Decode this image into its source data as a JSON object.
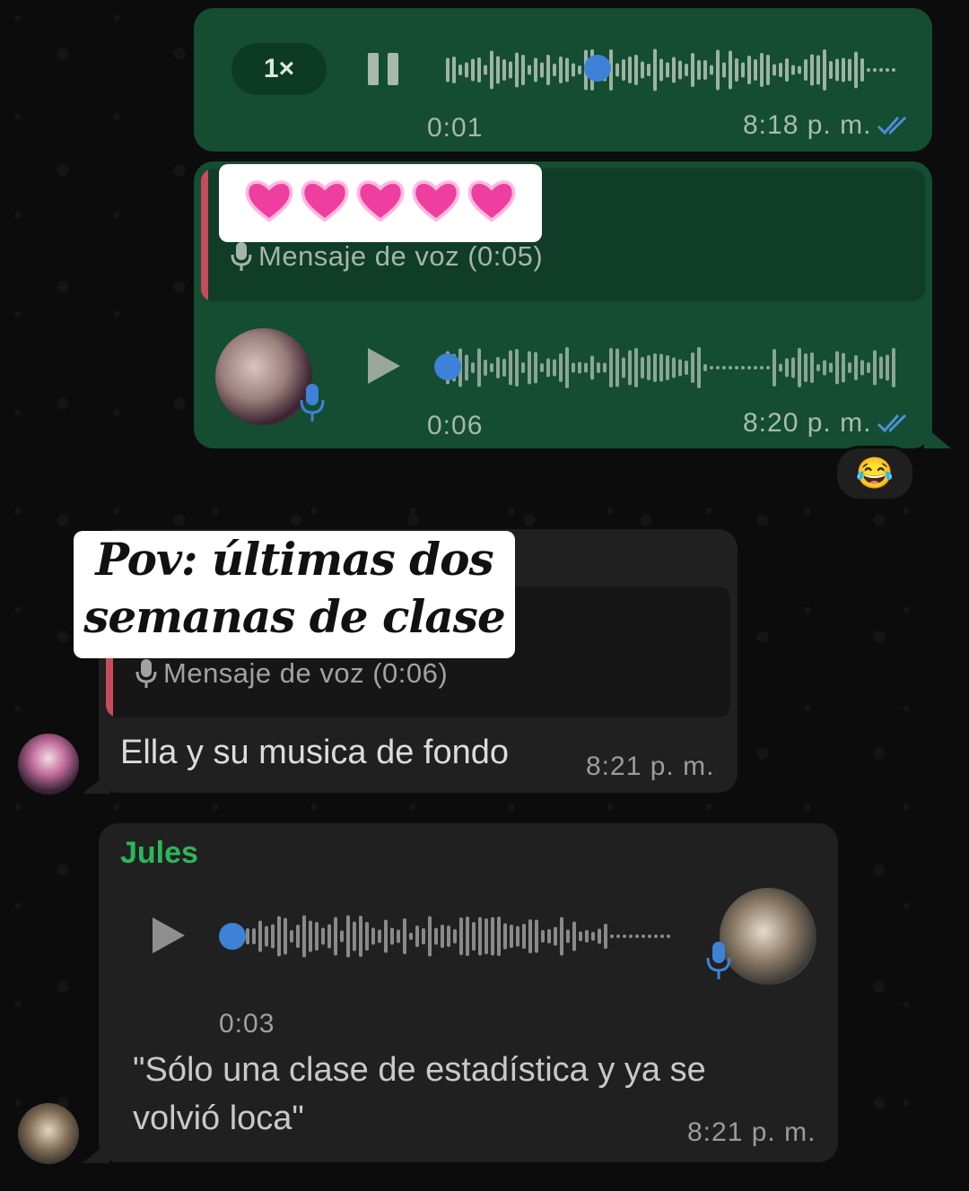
{
  "messages": {
    "m1": {
      "speed": "1×",
      "duration": "0:01",
      "time": "8:18 p. m."
    },
    "m2": {
      "quote_overlay": "💗💗💗💗💗",
      "quote_label": "Mensaje de voz (0:05)",
      "duration": "0:06",
      "time": "8:20 p. m.",
      "reaction": "😂"
    },
    "m3": {
      "overlay_line1": "Pov: últimas dos",
      "overlay_line2": "semanas de clase",
      "quote_label": "Mensaje de voz (0:06)",
      "text": "Ella y su musica de fondo",
      "time": "8:21 p. m."
    },
    "m4": {
      "sender": "Jules",
      "duration": "0:03",
      "line1": "\"Sólo una clase de estadística y ya se",
      "line2": "volvió loca\"",
      "time": "8:21 p. m."
    }
  },
  "colors": {
    "outgoing_bubble": "#144d31",
    "incoming_bubble": "#202020",
    "read_ticks": "#4d8fd9",
    "sender_name": "#2fb55a",
    "playhead": "#3d82d6"
  },
  "icons": [
    "pause-icon",
    "play-icon",
    "mic-icon",
    "read-ticks-icon",
    "microphone-small-icon"
  ]
}
